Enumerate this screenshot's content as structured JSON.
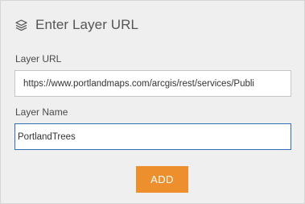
{
  "header": {
    "icon": "layers-icon",
    "title": "Enter Layer URL"
  },
  "layer_url": {
    "label": "Layer URL",
    "value": "https://www.portlandmaps.com/arcgis/rest/services/Publi"
  },
  "layer_name": {
    "label": "Layer Name",
    "value": "PortlandTrees"
  },
  "add_button": {
    "label": "ADD",
    "color": "#ed8f2c"
  },
  "colors": {
    "panel_bg": "#efefef",
    "focus_border": "#2f6fb5"
  }
}
